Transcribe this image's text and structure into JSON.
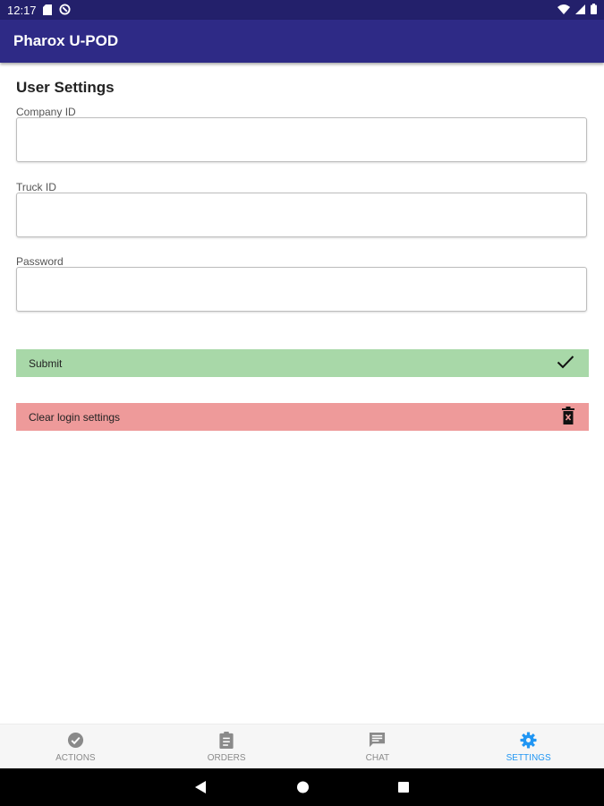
{
  "status_bar": {
    "time": "12:17",
    "left_icons": [
      "sd-card-icon",
      "data-saver-icon"
    ],
    "right_icons": [
      "wifi-icon",
      "signal-icon",
      "battery-icon"
    ]
  },
  "app_bar": {
    "title": "Pharox U-POD",
    "color": "#2e2a86"
  },
  "settings": {
    "title": "User Settings",
    "fields": [
      {
        "label": "Company ID",
        "value": "",
        "placeholder": ""
      },
      {
        "label": "Truck ID",
        "value": "",
        "placeholder": ""
      },
      {
        "label": "Password",
        "value": "",
        "placeholder": ""
      }
    ],
    "submit": {
      "label": "Submit",
      "icon": "checkmark-icon",
      "color": "#a8d8a8"
    },
    "clear": {
      "label": "Clear login settings",
      "icon": "trash-icon",
      "color": "#ee9a9a"
    }
  },
  "bottom_nav": {
    "items": [
      {
        "label": "ACTIONS",
        "icon": "check-circle-icon",
        "active": false
      },
      {
        "label": "ORDERS",
        "icon": "clipboard-icon",
        "active": false
      },
      {
        "label": "CHAT",
        "icon": "chat-icon",
        "active": false
      },
      {
        "label": "SETTINGS",
        "icon": "gear-icon",
        "active": true
      }
    ],
    "active_color": "#2196f3"
  },
  "system_nav": {
    "buttons": [
      "back-icon",
      "home-icon",
      "recents-icon"
    ]
  }
}
